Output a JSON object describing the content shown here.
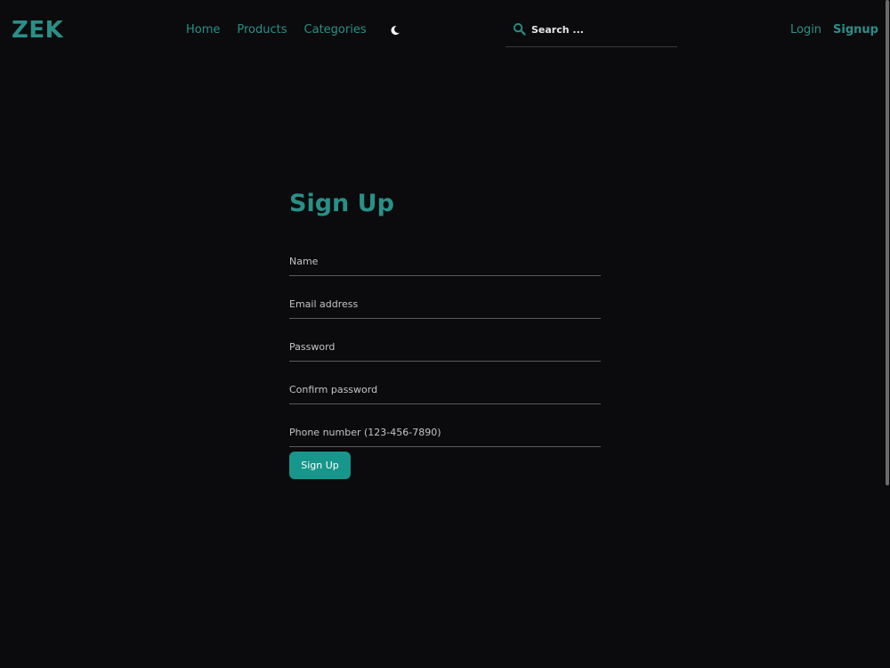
{
  "navbar": {
    "logo": "ZEK",
    "links": {
      "home": "Home",
      "products": "Products",
      "categories": "Categories"
    },
    "theme_icon": "moon-icon",
    "search": {
      "placeholder": "Search ...",
      "icon": "search-icon"
    },
    "auth": {
      "login": "Login",
      "signup": "Signup"
    }
  },
  "form": {
    "title": "Sign Up",
    "fields": {
      "name": "Name",
      "email": "Email address",
      "password": "Password",
      "confirm_password": "Confirm password",
      "phone": "Phone number (123-456-7890)"
    },
    "submit_label": "Sign Up"
  },
  "colors": {
    "background": "#0b0b0d",
    "accent": "#2a8f87",
    "button": "#17968b"
  }
}
